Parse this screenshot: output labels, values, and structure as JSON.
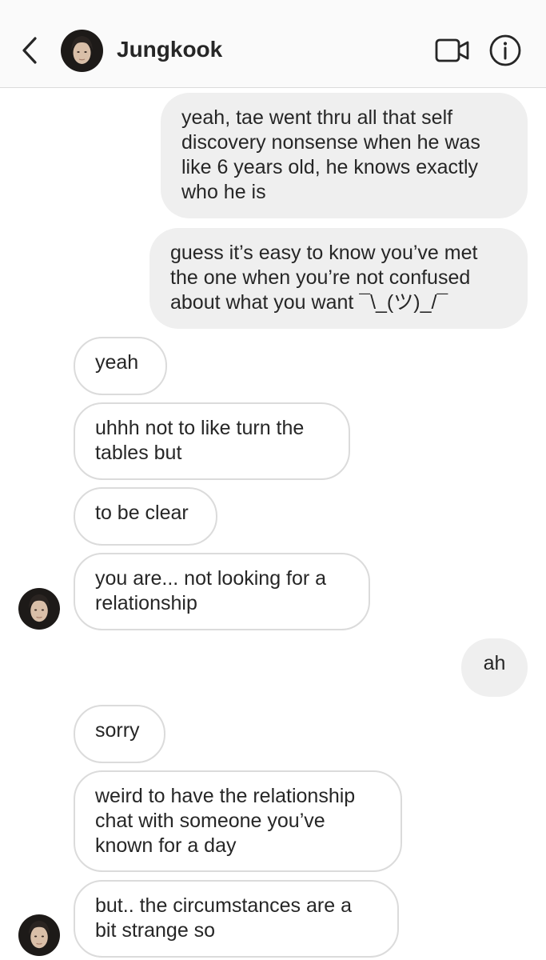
{
  "header": {
    "name": "Jungkook",
    "icons": [
      "chevron-left-icon",
      "video-camera-icon",
      "info-icon"
    ]
  },
  "messages": [
    {
      "from": "me",
      "text": "yeah, tae went thru all that self\ndiscovery nonsense when he was\nlike 6 years old, he knows exactly\nwho he is"
    },
    {
      "from": "me",
      "text": "guess it’s easy to know you’ve met\nthe one when you’re not confused\nabout what you want ¯\\_(ツ)_/¯"
    },
    {
      "from": "them",
      "text": "yeah"
    },
    {
      "from": "them",
      "text": "uhhh not to like turn the\ntables but"
    },
    {
      "from": "them",
      "text": "to be clear"
    },
    {
      "from": "them",
      "text": "you are... not looking for a\nrelationship"
    },
    {
      "from": "me",
      "text": "ah"
    },
    {
      "from": "them",
      "text": "sorry"
    },
    {
      "from": "them",
      "text": "weird to have the relationship\nchat with someone you’ve\nknown for a day"
    },
    {
      "from": "them",
      "text": "but.. the circumstances are a\nbit strange so"
    }
  ]
}
